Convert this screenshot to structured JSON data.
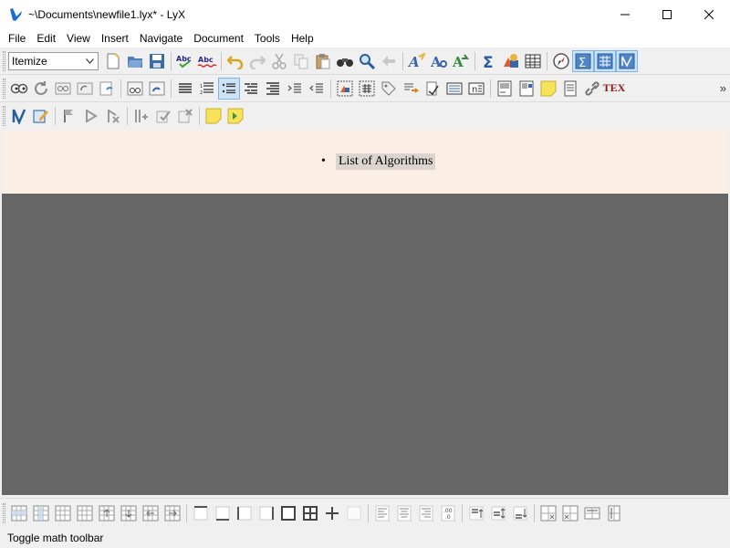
{
  "window": {
    "title": "~\\Documents\\newfile1.lyx* - LyX",
    "minimize_glyph": "—",
    "maximize_glyph": "☐",
    "close_glyph": "✕"
  },
  "menu": [
    "File",
    "Edit",
    "View",
    "Insert",
    "Navigate",
    "Document",
    "Tools",
    "Help"
  ],
  "toolbar1": {
    "layout_value": "Itemize",
    "layout_options": [
      "Itemize"
    ],
    "buttons": [
      "new-document",
      "open-document",
      "save-document",
      "spellcheck",
      "spellcheck-continuous",
      "undo",
      "redo",
      "cut",
      "copy",
      "paste",
      "find-replace",
      "find",
      "back",
      "text-style",
      "character-style",
      "math-mode",
      "math-panel",
      "insert-graphics",
      "insert-table",
      "view-source",
      "toggle-math-toolbar",
      "toggle-table-toolbar",
      "toggle-review-toolbar"
    ]
  },
  "toolbar2": {
    "buttons": [
      "view-pdf",
      "update-pdf",
      "view-master",
      "update-master",
      "rebuild",
      "view-other",
      "update-other",
      "align-standard",
      "enumerate-list",
      "itemize-list",
      "description-list",
      "list-decrease-depth",
      "list-increase-depth",
      "list-outdent",
      "insert-figure",
      "insert-table-float",
      "insert-label",
      "insert-cross-ref",
      "insert-citation",
      "insert-index",
      "insert-nomenclature",
      "insert-footnote",
      "insert-margin-note",
      "insert-note",
      "insert-box",
      "insert-url",
      "insert-tex-code"
    ],
    "tex_label": "TEX",
    "overflow": "»"
  },
  "toolbar3": {
    "buttons": [
      "review-track-changes",
      "review-edit",
      "review-next-change",
      "review-accept",
      "review-reject",
      "review-merge",
      "review-accept-all",
      "review-reject-all",
      "insert-comment",
      "next-comment"
    ]
  },
  "document": {
    "bullet": "•",
    "item_text": "List of Algorithms"
  },
  "bottom_toolbar": {
    "buttons": [
      "table-add-row",
      "table-add-column",
      "table-delete-row",
      "table-delete-column",
      "table-move-row-up",
      "table-move-row-down",
      "table-move-column-left",
      "table-move-column-right",
      "border-top",
      "border-bottom",
      "border-left",
      "border-right",
      "border-outer",
      "border-all",
      "border-inner",
      "border-none",
      "align-left",
      "align-center",
      "align-right",
      "align-decimal",
      "valign-top",
      "valign-middle",
      "valign-bottom",
      "table-multicolumn",
      "table-multirow",
      "table-set-width",
      "table-set-height"
    ],
    "decimal_label": ".00\n.0"
  },
  "status": {
    "text": "Toggle math toolbar"
  }
}
